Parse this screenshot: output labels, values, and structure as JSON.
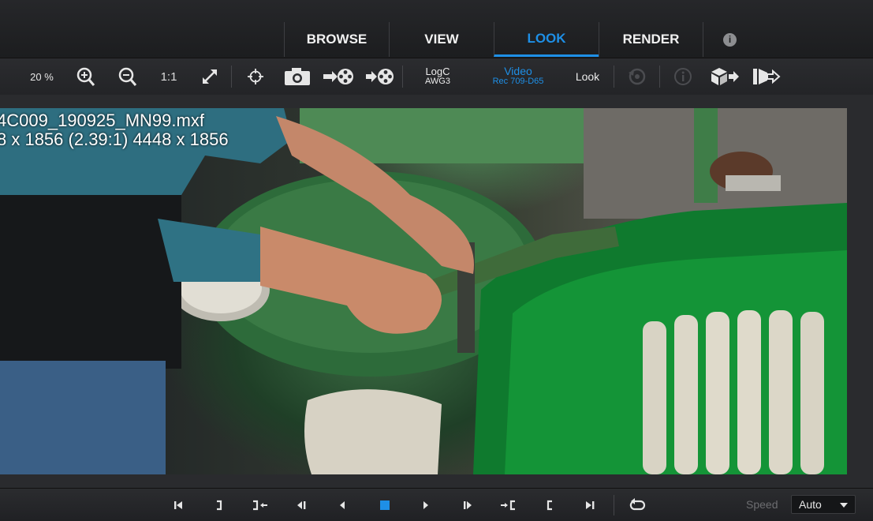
{
  "tabs": [
    {
      "label": "BROWSE"
    },
    {
      "label": "VIEW"
    },
    {
      "label": "LOOK"
    },
    {
      "label": "RENDER"
    }
  ],
  "active_tab": "LOOK",
  "toolbar": {
    "zoom": "20 %",
    "one_to_one": "1:1",
    "input_space": {
      "top": "LogC",
      "bottom": "AWG3"
    },
    "output_space": {
      "top": "Video",
      "bottom": "Rec 709-D65"
    },
    "look_label": "Look"
  },
  "viewer": {
    "filename": "4C009_190925_MN99.mxf",
    "resolution": "8 x 1856 (2.39:1)  4448 x 1856"
  },
  "transport": {
    "speed_label": "Speed",
    "speed_value": "Auto"
  },
  "colors": {
    "accent": "#1e8fe6",
    "background": "#1e1f21"
  },
  "icons": [
    "zoom-in-icon",
    "zoom-out-icon",
    "fullscreen-icon",
    "crosshair-icon",
    "camera-icon",
    "film-export-icon",
    "film-import-icon",
    "reset-look-icon",
    "info-icon",
    "cube-export-icon",
    "frame-export-icon",
    "go-to-start-icon",
    "mark-out-icon",
    "go-to-out-icon",
    "step-back-icon",
    "play-reverse-icon",
    "stop-icon",
    "play-icon",
    "step-forward-icon",
    "go-to-in-icon",
    "mark-in-icon",
    "go-to-end-icon",
    "loop-icon"
  ]
}
